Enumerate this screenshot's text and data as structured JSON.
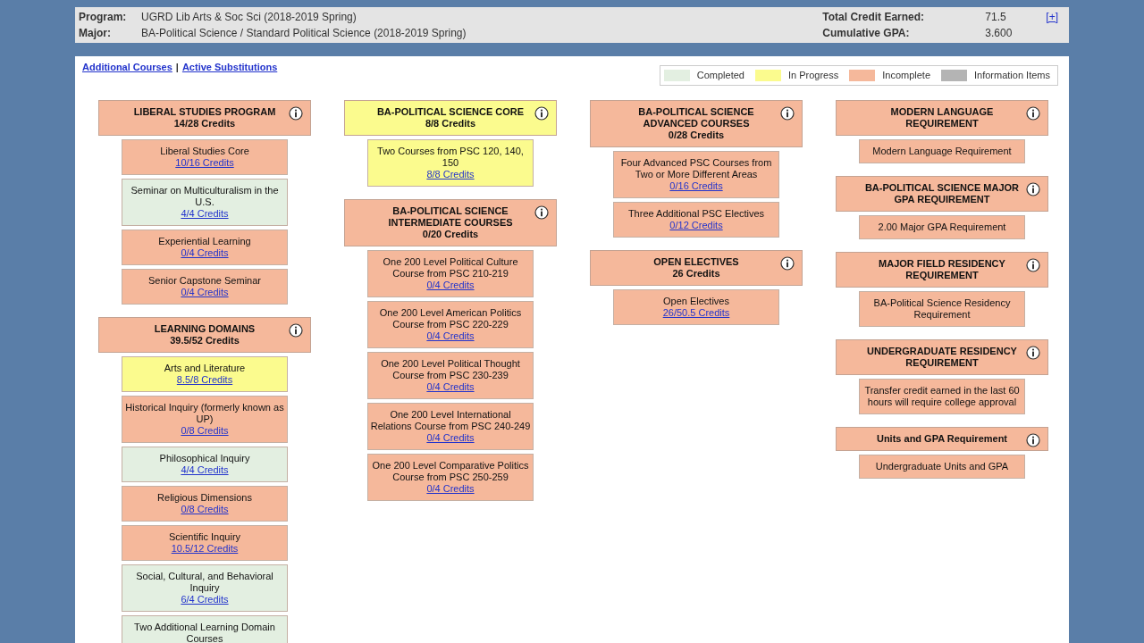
{
  "program_info": {
    "rows": [
      {
        "label": "Program:",
        "value": "UGRD Lib Arts & Soc Sci (2018-2019 Spring)"
      },
      {
        "label": "Major:",
        "value": "BA-Political Science / Standard Political Science (2018-2019 Spring)"
      }
    ],
    "totals": [
      {
        "label": "Total Credit Earned:",
        "value": "71.5"
      },
      {
        "label": "Cumulative GPA:",
        "value": "3.600"
      }
    ],
    "expand_link": "[+]"
  },
  "links": [
    "Additional Courses",
    "Active Substitutions"
  ],
  "link_separator": "|",
  "legend": [
    {
      "label": "Completed",
      "color": "#e3efe1"
    },
    {
      "label": "In Progress",
      "color": "#fbfb8e"
    },
    {
      "label": "Incomplete",
      "color": "#f5b89b"
    },
    {
      "label": "Information Items",
      "color": "#b4b4b4"
    }
  ],
  "columns": [
    [
      {
        "title": "LIBERAL STUDIES PROGRAM",
        "credits": "14/28 Credits",
        "color": "#f5b89b",
        "items": [
          {
            "name": "Liberal Studies Core",
            "credits": "10/16 Credits",
            "color": "#f5b89b"
          },
          {
            "name": "Seminar on Multiculturalism in the U.S.",
            "credits": "4/4 Credits",
            "color": "#e3efe1"
          },
          {
            "name": "Experiential Learning",
            "credits": "0/4 Credits",
            "color": "#f5b89b"
          },
          {
            "name": "Senior Capstone Seminar",
            "credits": "0/4 Credits",
            "color": "#f5b89b"
          }
        ]
      },
      {
        "title": "LEARNING DOMAINS",
        "credits": "39.5/52 Credits",
        "color": "#f5b89b",
        "items": [
          {
            "name": "Arts and Literature",
            "credits": "8.5/8 Credits",
            "color": "#fbfb8e"
          },
          {
            "name": "Historical Inquiry (formerly known as UP)",
            "credits": "0/8 Credits",
            "color": "#f5b89b"
          },
          {
            "name": "Philosophical Inquiry",
            "credits": "4/4 Credits",
            "color": "#e3efe1"
          },
          {
            "name": "Religious Dimensions",
            "credits": "0/8 Credits",
            "color": "#f5b89b"
          },
          {
            "name": "Scientific Inquiry",
            "credits": "10.5/12 Credits",
            "color": "#f5b89b"
          },
          {
            "name": "Social, Cultural, and Behavioral Inquiry",
            "credits": "6/4 Credits",
            "color": "#e3efe1"
          },
          {
            "name": "Two Additional Learning Domain Courses",
            "color": "#e3efe1"
          }
        ]
      }
    ],
    [
      {
        "title": "BA-POLITICAL SCIENCE CORE",
        "credits": "8/8 Credits",
        "color": "#fbfb8e",
        "items": [
          {
            "name": "Two Courses from PSC 120, 140, 150",
            "credits": "8/8 Credits",
            "color": "#fbfb8e"
          }
        ]
      },
      {
        "title": "BA-POLITICAL SCIENCE INTERMEDIATE COURSES",
        "credits": "0/20 Credits",
        "color": "#f5b89b",
        "items": [
          {
            "name": "One 200 Level Political Culture Course from PSC 210-219",
            "credits": "0/4 Credits",
            "color": "#f5b89b"
          },
          {
            "name": "One 200 Level American Politics Course from PSC 220-229",
            "credits": "0/4 Credits",
            "color": "#f5b89b"
          },
          {
            "name": "One 200 Level Political Thought Course from PSC 230-239",
            "credits": "0/4 Credits",
            "color": "#f5b89b"
          },
          {
            "name": "One 200 Level International Relations Course from PSC 240-249",
            "credits": "0/4 Credits",
            "color": "#f5b89b"
          },
          {
            "name": "One 200 Level Comparative Politics Course from PSC 250-259",
            "credits": "0/4 Credits",
            "color": "#f5b89b"
          }
        ]
      }
    ],
    [
      {
        "title": "BA-POLITICAL SCIENCE ADVANCED COURSES",
        "credits": "0/28 Credits",
        "color": "#f5b89b",
        "items": [
          {
            "name": "Four Advanced PSC Courses from Two or More Different Areas",
            "credits": "0/16 Credits",
            "color": "#f5b89b"
          },
          {
            "name": "Three Additional PSC Electives",
            "credits": "0/12 Credits",
            "color": "#f5b89b"
          }
        ]
      },
      {
        "title": "OPEN ELECTIVES",
        "credits": "26 Credits",
        "color": "#f5b89b",
        "items": [
          {
            "name": "Open Electives",
            "credits": "26/50.5 Credits",
            "color": "#f5b89b"
          }
        ]
      }
    ],
    [
      {
        "title": "MODERN LANGUAGE REQUIREMENT",
        "color": "#f5b89b",
        "items": [
          {
            "name": "Modern Language Requirement",
            "color": "#f5b89b"
          }
        ]
      },
      {
        "title": "BA-POLITICAL SCIENCE MAJOR GPA REQUIREMENT",
        "color": "#f5b89b",
        "items": [
          {
            "name": "2.00 Major GPA Requirement",
            "color": "#f5b89b"
          }
        ]
      },
      {
        "title": "MAJOR FIELD RESIDENCY REQUIREMENT",
        "color": "#f5b89b",
        "items": [
          {
            "name": "BA-Political Science Residency Requirement",
            "color": "#f5b89b"
          }
        ]
      },
      {
        "title": "UNDERGRADUATE RESIDENCY REQUIREMENT",
        "color": "#f5b89b",
        "items": [
          {
            "name": "Transfer credit earned in the last 60 hours will require college approval",
            "color": "#f5b89b"
          }
        ]
      },
      {
        "title": "Units and GPA Requirement",
        "color": "#f5b89b",
        "items": [
          {
            "name": "Undergraduate Units and GPA",
            "color": "#f5b89b"
          }
        ]
      }
    ]
  ]
}
